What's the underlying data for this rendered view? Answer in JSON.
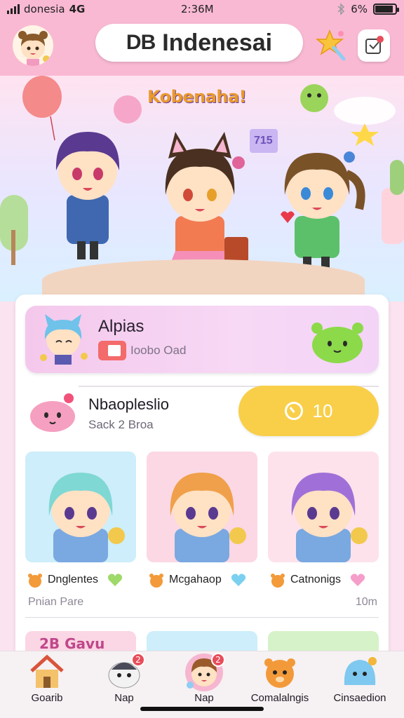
{
  "status_bar": {
    "carrier": "donesia",
    "network": "4G",
    "time": "2:36M",
    "battery": "6%",
    "battery_level": 0.9
  },
  "header": {
    "logo_mark": "DB",
    "app_title": "Indenesai",
    "icons": {
      "avatar": "avatar-icon",
      "star": "star-icon",
      "notification": "notification-icon"
    }
  },
  "hero": {
    "banner_title": "Kobenaha!",
    "sign_text": "715"
  },
  "featured": {
    "title": "Alpias",
    "subtitle": "Ioobo Oad",
    "icons": {
      "character": "character-icon",
      "badge": "ticket-icon",
      "mascot": "slime-icon"
    }
  },
  "offer": {
    "title": "Nbaoplеslio",
    "subtitle": "Sack 2 Broa",
    "button_label": "10",
    "icons": {
      "mascot": "pink-slime-icon",
      "timer": "clock-icon"
    }
  },
  "grid_items": [
    {
      "label": "Dnglentes",
      "bg": "#cdeefa",
      "icon": "heart-icon",
      "heart_color": "#9ed96a"
    },
    {
      "label": "Mcgahaop",
      "bg": "#fbd8e4",
      "icon": "heart-icon",
      "heart_color": "#7bd0f0"
    },
    {
      "label": "Catnonigs",
      "bg": "#fde2ec",
      "icon": "heart-icon",
      "heart_color": "#f59ec9"
    }
  ],
  "list_footer": {
    "left": "Pnian Pare",
    "right": "10m"
  },
  "peek_items": [
    {
      "text": "2B Gavu",
      "bg": "#fbd6e4"
    },
    {
      "text": "",
      "bg": "#cdeefa"
    },
    {
      "text": "",
      "bg": "#d6f2c8"
    }
  ],
  "bottom_nav": [
    {
      "label": "Goarib",
      "icon": "house-icon",
      "badge": ""
    },
    {
      "label": "Nap",
      "icon": "seal-icon",
      "badge": "2"
    },
    {
      "label": "Nap",
      "icon": "character-icon",
      "badge": "2"
    },
    {
      "label": "Comalalngis",
      "icon": "bear-icon",
      "badge": ""
    },
    {
      "label": "Cinsaedion",
      "icon": "slime-icon",
      "badge": ""
    }
  ]
}
